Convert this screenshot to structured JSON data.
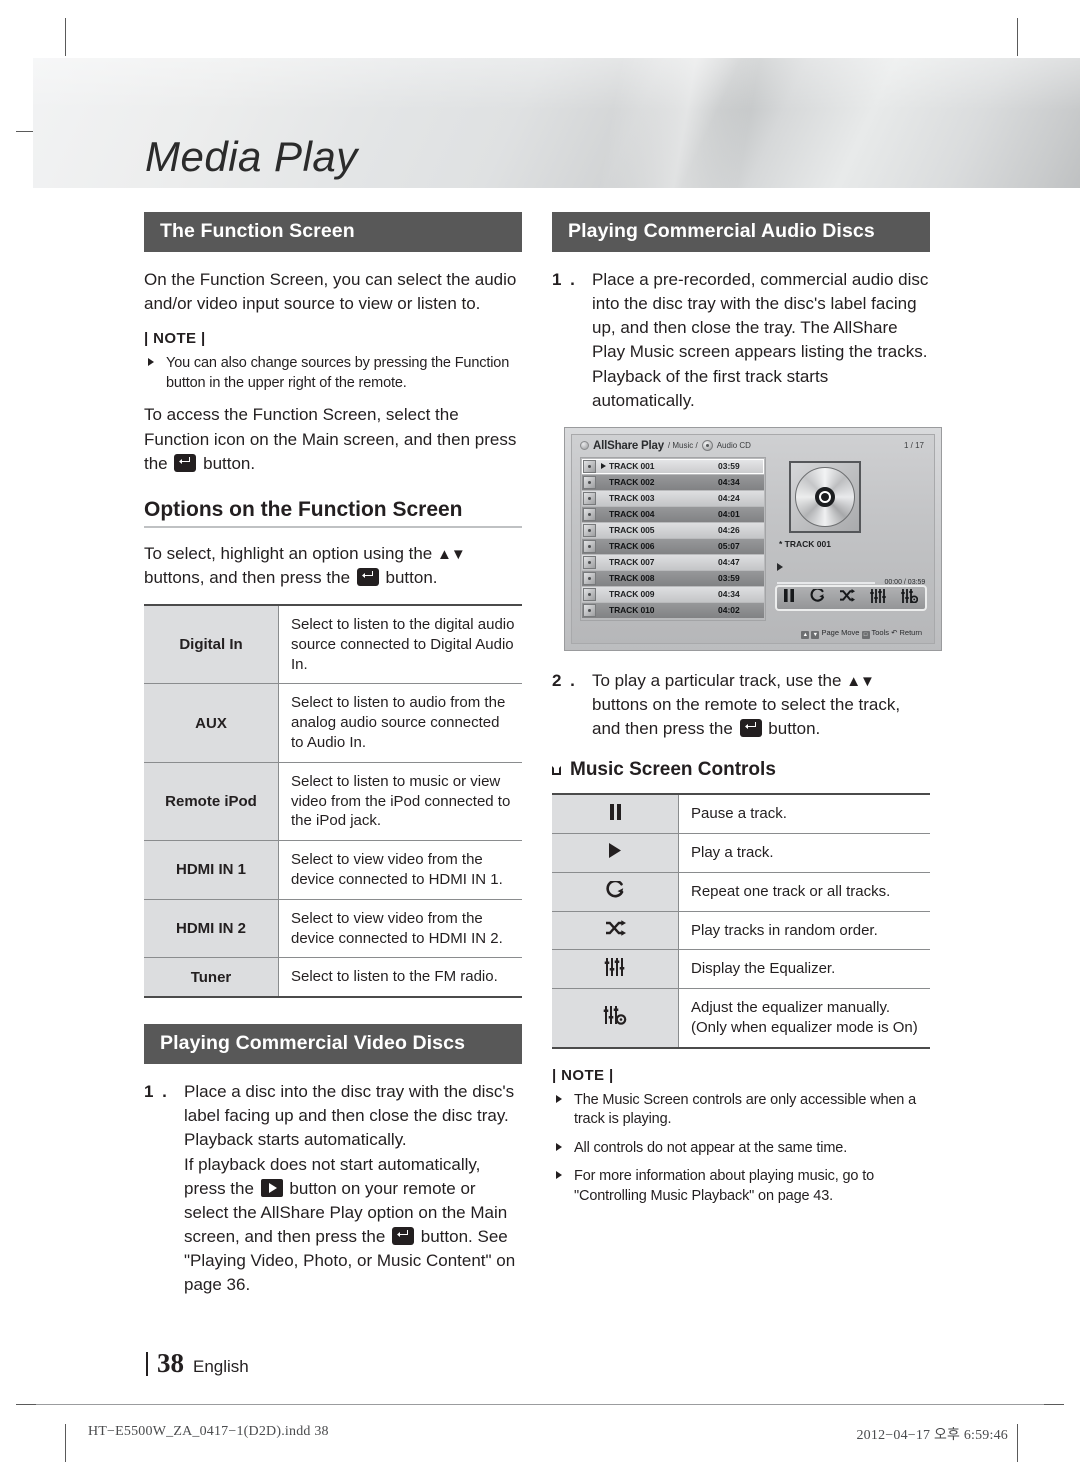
{
  "header": {
    "chapter_title": "Media Play"
  },
  "left_column": {
    "section1": {
      "bar_title": "The Function Screen",
      "intro": "On the Function Screen, you can select the audio and/or video input source to view or listen to.",
      "note_label": "| NOTE |",
      "notes": [
        "You can also change sources by pressing the Function button in the upper right of the remote."
      ],
      "para2_a": "To access the Function Screen, select the Function icon on the Main screen, and then press the",
      "para2_b": "button.",
      "sub_head": "Options on the Function Screen",
      "sub_intro_a": "To select, highlight an option using the",
      "sub_intro_arrows": "▲▼",
      "sub_intro_b": "buttons, and then press the",
      "sub_intro_c": "button.",
      "options_table": [
        {
          "option": "Digital In",
          "description": "Select to listen to the digital audio source connected to Digital Audio In."
        },
        {
          "option": "AUX",
          "description": "Select to listen to audio from the analog audio source connected to Audio In."
        },
        {
          "option": "Remote iPod",
          "description": "Select to listen to music or view video from the iPod connected to the iPod jack."
        },
        {
          "option": "HDMI IN 1",
          "description": "Select to view video from the device connected to HDMI IN 1."
        },
        {
          "option": "HDMI IN 2",
          "description": "Select to view video from the device connected to HDMI IN 2."
        },
        {
          "option": "Tuner",
          "description": "Select to listen to the FM radio."
        }
      ]
    },
    "section2": {
      "bar_title": "Playing Commercial Video Discs",
      "step_number": "1 .",
      "step_text_a": "Place a disc into the disc tray with the disc's label facing up and then close the disc tray. Playback starts automatically.",
      "step_text_b": "If playback does not start automatically, press the",
      "step_text_c": "button on your remote or select the AllShare Play option on the Main screen, and then press the",
      "step_text_d": "button. See \"Playing Video, Photo, or Music Content\" on page 36."
    }
  },
  "right_column": {
    "section1": {
      "bar_title": "Playing Commercial Audio Discs",
      "step_number": "1 .",
      "step_text": "Place a pre-recorded, commercial audio disc into the disc tray with the disc's label facing up, and then close the tray. The AllShare Play Music screen appears listing the tracks. Playback of the first track starts automatically."
    },
    "ui_screenshot": {
      "brand": "AllShare Play",
      "breadcrumb_music": "/ Music /",
      "breadcrumb_source": "Audio CD",
      "page_indicator": "1 / 17",
      "tracks": [
        {
          "name": "TRACK 001",
          "time": "03:59",
          "selected": true
        },
        {
          "name": "TRACK 002",
          "time": "04:34",
          "selected": false
        },
        {
          "name": "TRACK 003",
          "time": "04:24",
          "selected": false
        },
        {
          "name": "TRACK 004",
          "time": "04:01",
          "selected": false
        },
        {
          "name": "TRACK 005",
          "time": "04:26",
          "selected": false
        },
        {
          "name": "TRACK 006",
          "time": "05:07",
          "selected": false
        },
        {
          "name": "TRACK 007",
          "time": "04:47",
          "selected": false
        },
        {
          "name": "TRACK 008",
          "time": "03:59",
          "selected": false
        },
        {
          "name": "TRACK 009",
          "time": "04:34",
          "selected": false
        },
        {
          "name": "TRACK 010",
          "time": "04:02",
          "selected": false
        }
      ],
      "now_playing": "* TRACK 001",
      "elapsed_total": "00:00 / 03:59",
      "footbar": {
        "page_move": "Page Move",
        "tools": "Tools",
        "return": "Return"
      }
    },
    "step2": {
      "step_number": "2 .",
      "text_a": "To play a particular track, use the",
      "arrows": "▲▼",
      "text_b": "buttons on the remote to select the track, and then press the",
      "text_c": "button."
    },
    "controls_heading": "Music Screen Controls",
    "controls_table": [
      {
        "icon": "pause-icon",
        "description": "Pause a track."
      },
      {
        "icon": "play-icon",
        "description": "Play a track."
      },
      {
        "icon": "repeat-icon",
        "description": "Repeat one track or all tracks."
      },
      {
        "icon": "shuffle-icon",
        "description": "Play tracks in random order."
      },
      {
        "icon": "equalizer-icon",
        "description": "Display the Equalizer."
      },
      {
        "icon": "equalizer-settings-icon",
        "description": "Adjust the equalizer manually.\n(Only when equalizer mode is On)"
      }
    ],
    "note_label": "| NOTE |",
    "notes": [
      "The Music Screen controls are only accessible when a track is playing.",
      "All controls do not appear at the same time.",
      "For more information about playing music, go to \"Controlling Music Playback\" on page 43."
    ]
  },
  "footer": {
    "page_number": "38",
    "language": "English",
    "imprint_left": "HT−E5500W_ZA_0417−1(D2D).indd   38",
    "imprint_right": "2012−04−17   오후 6:59:46"
  }
}
